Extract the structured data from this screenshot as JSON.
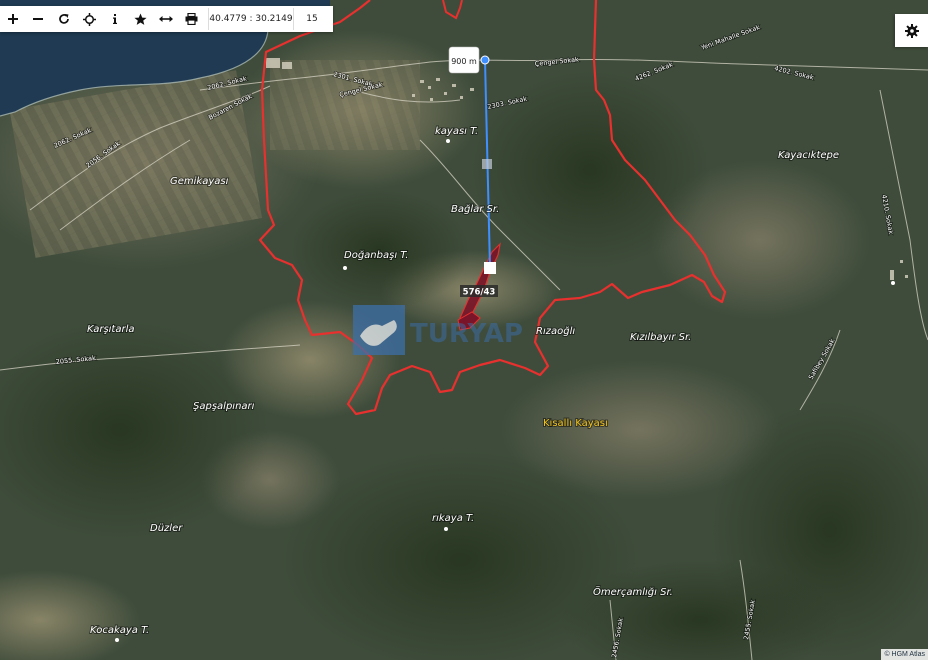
{
  "toolbar": {
    "buttons": [
      {
        "name": "zoom-in-button",
        "icon": "plus-icon"
      },
      {
        "name": "zoom-out-button",
        "icon": "minus-icon"
      },
      {
        "name": "refresh-button",
        "icon": "refresh-icon"
      },
      {
        "name": "locate-button",
        "icon": "crosshair-icon"
      },
      {
        "name": "info-button",
        "icon": "info-icon"
      },
      {
        "name": "favorite-button",
        "icon": "star-icon"
      },
      {
        "name": "measure-button",
        "icon": "measure-icon"
      },
      {
        "name": "print-button",
        "icon": "printer-icon"
      }
    ],
    "coordinates": "40.4779 : 30.2149",
    "zoom_level": "15"
  },
  "measure": {
    "label": "900 m"
  },
  "parcel": {
    "label": "576/43"
  },
  "place_names": {
    "gemikayasi": "Gemikayası",
    "kayacıktepe": "Kayacıktepe",
    "baglar": "Bağlar Sr.",
    "doganbasi": "Doğanbaşı T.",
    "karsitarla": "Karşıtarla",
    "rizaogli": "Rızaoğlı",
    "kizilbayir": "Kızılbayır Sr.",
    "sapsalpinari": "Şapşalpınarı",
    "kisalli": "Kısallı Kayası",
    "duzler": "Düzler",
    "rikaya": "rıkaya T.",
    "omercamligi": "Ömerçamlığı Sr.",
    "kocakaya": "Kocakaya T.",
    "kayasi": "kayası T."
  },
  "road_names": {
    "s2301": "2301. Sokak",
    "cengel1": "Çengel Sokak",
    "cengel2": "Çengel Sokak",
    "s2303": "2303. Sokak",
    "yenimahalle": "Yeni Mahalle Sokak",
    "s4262": "4262. Sokak",
    "s4202": "4202. Sokak",
    "s2062a": "2062. Sokak",
    "s2062b": "2062. Sokak",
    "bozaren": "Bozaren Sokak",
    "s2056": "2056. Sokak",
    "s2055": "2055. Sokak",
    "safibey": "Safibey Sokak",
    "s4210": "4210. Sokak",
    "s2455": "2455. Sokak",
    "s2456": "2456. Sokak"
  },
  "watermark": {
    "text": "TURYAP"
  },
  "attribution": "© HGM Atlas",
  "colors": {
    "boundary": "#e8302e",
    "measure_line": "#3f8fff",
    "parcel": "#7a1428",
    "kisalli": "#f2c21a"
  }
}
